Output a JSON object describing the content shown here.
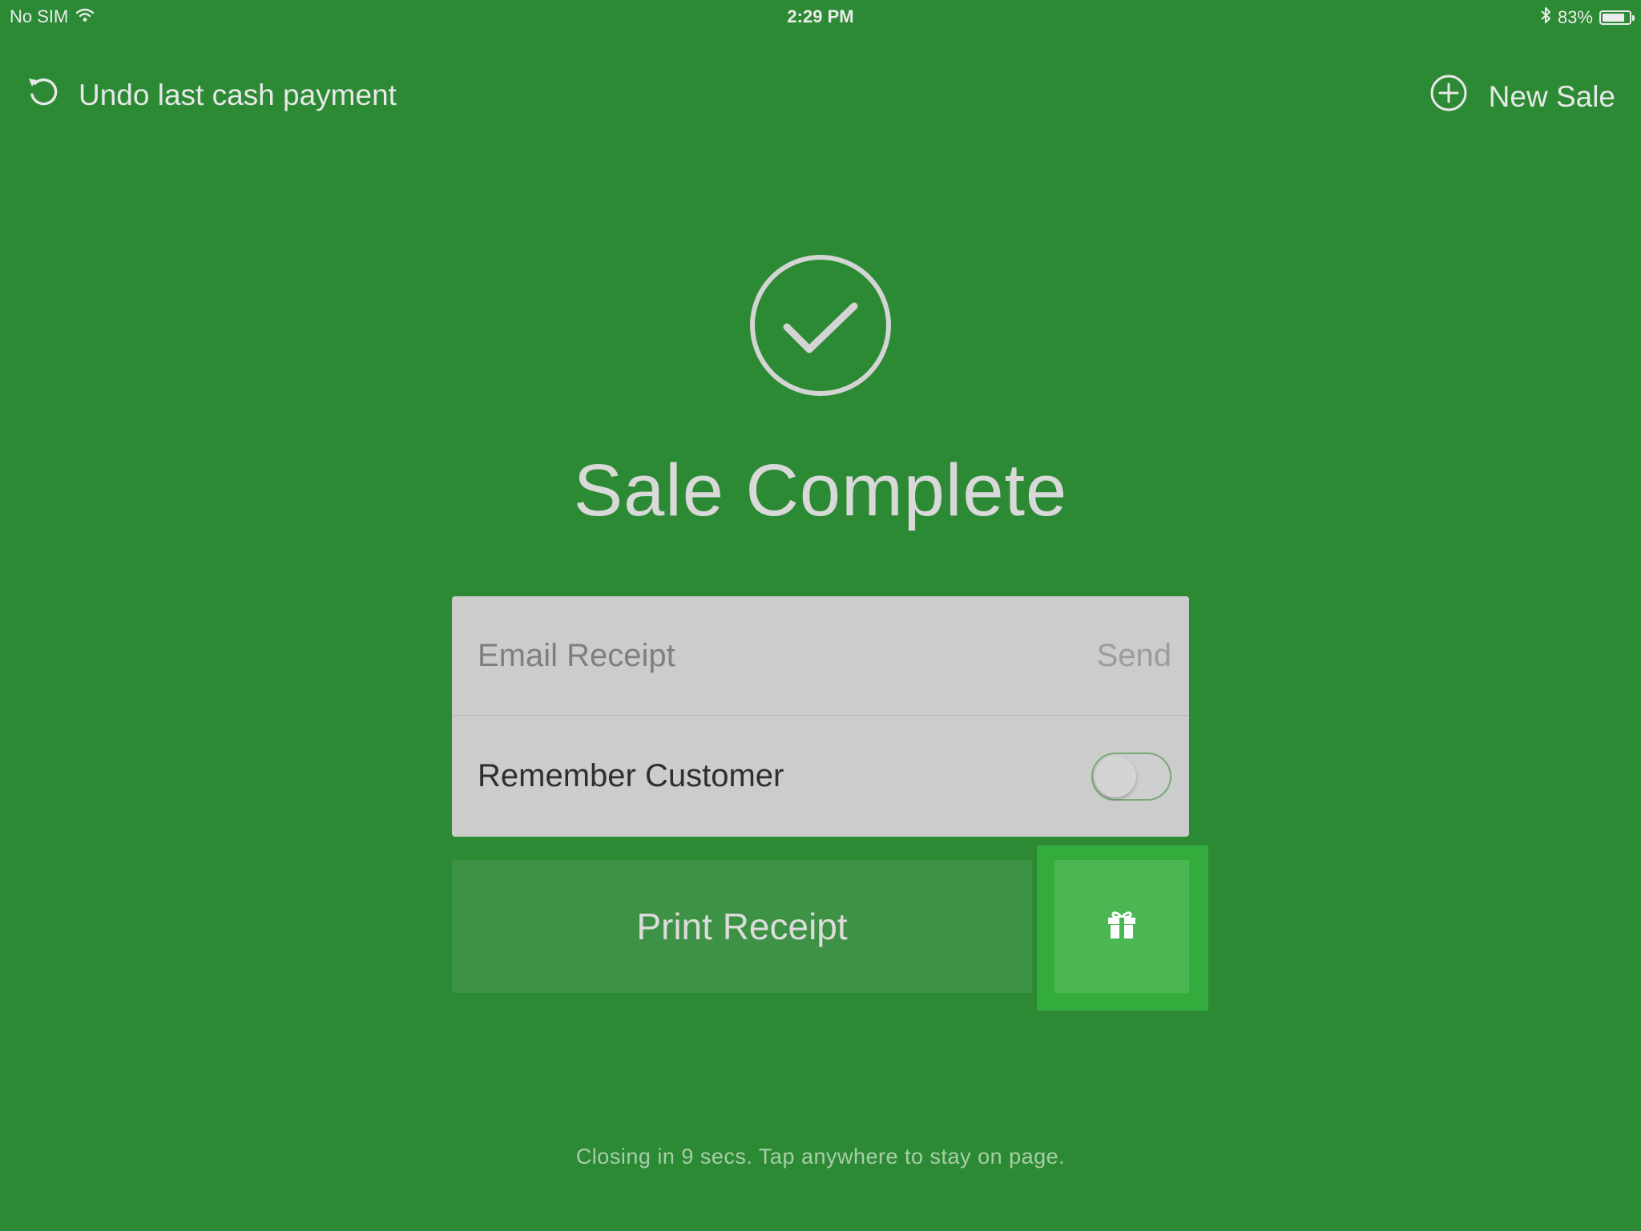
{
  "status_bar": {
    "carrier": "No SIM",
    "time": "2:29 PM",
    "battery_percent": "83%",
    "battery_level": 0.83,
    "icons": [
      "wifi-icon",
      "bluetooth-icon",
      "battery-icon"
    ]
  },
  "nav": {
    "undo_label": "Undo last cash payment",
    "new_sale_label": "New Sale"
  },
  "main": {
    "title": "Sale Complete",
    "email_receipt_label": "Email Receipt",
    "send_label": "Send",
    "remember_customer_label": "Remember Customer",
    "remember_customer_on": false,
    "print_receipt_label": "Print Receipt",
    "gift_icon": "gift-icon",
    "closing_note": "Closing in 9 secs. Tap anywhere to stay on page."
  },
  "colors": {
    "background": "#2c8a34",
    "card": "#cccccc",
    "print_button": "#3d9245",
    "gift_button": "#4bb752",
    "gift_button_highlight": "#33ab3d"
  }
}
